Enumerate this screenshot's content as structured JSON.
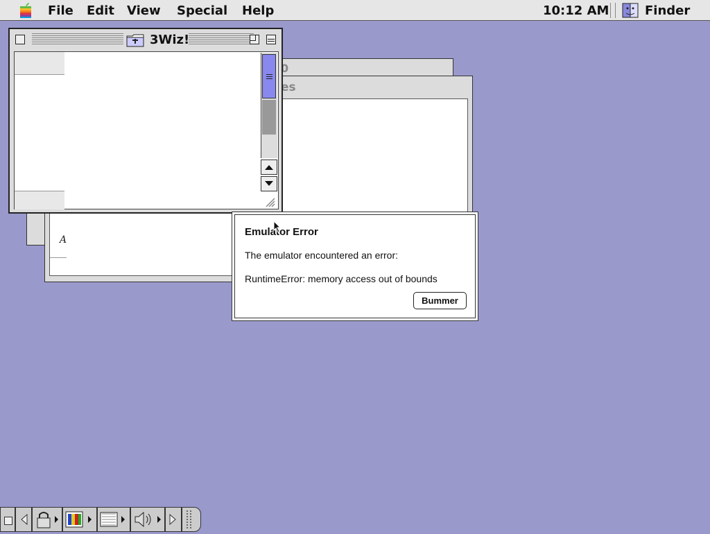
{
  "menubar": {
    "items": [
      "File",
      "Edit",
      "View",
      "Special",
      "Help"
    ],
    "clock": "10:12 AM",
    "app_name": "Finder"
  },
  "front_window": {
    "title": "3Wiz!"
  },
  "background_windows": {
    "title_fragment_1": "0",
    "title_fragment_2": "es",
    "content_fragment": "A"
  },
  "dialog": {
    "title": "Emulator Error",
    "message": "The emulator encountered an error:",
    "detail": "RuntimeError: memory access out of bounds",
    "button_label": "Bummer"
  },
  "colors": {
    "desktop": "#9999cc",
    "scroll_thumb": "#8888ee"
  },
  "icons": {
    "apple": "apple-logo-icon",
    "finder": "finder-face-icon",
    "folder": "folder-icon"
  }
}
